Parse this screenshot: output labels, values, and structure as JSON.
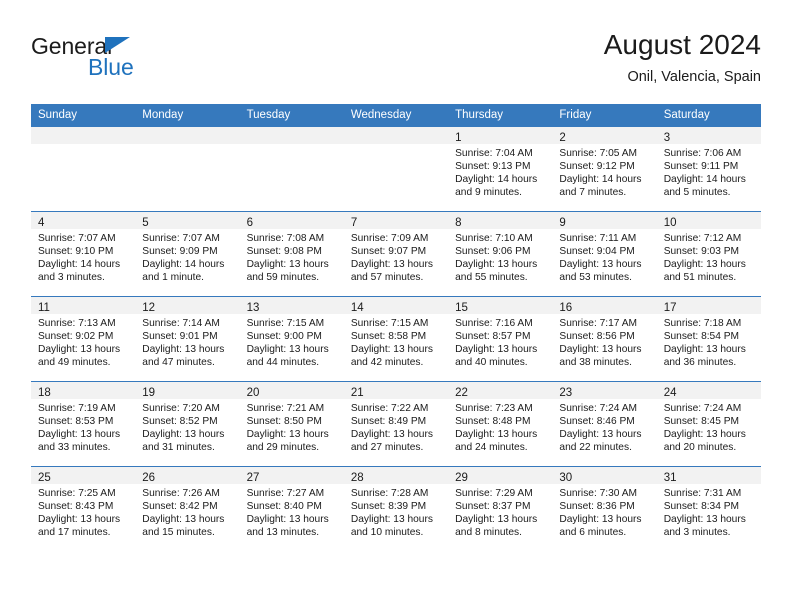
{
  "brand": {
    "name_top": "General",
    "name_bottom": "Blue",
    "triangle_color": "#1f72bd"
  },
  "header": {
    "title": "August 2024",
    "subtitle": "Onil, Valencia, Spain"
  },
  "theme": {
    "header_row_bg": "#3679bd",
    "header_row_text": "#ffffff",
    "daynum_band_bg": "#f2f2f2",
    "cell_border": "#3679bd",
    "text": "#1b1b1b"
  },
  "weekday_headers": [
    "Sunday",
    "Monday",
    "Tuesday",
    "Wednesday",
    "Thursday",
    "Friday",
    "Saturday"
  ],
  "labels": {
    "sunrise_prefix": "Sunrise:",
    "sunset_prefix": "Sunset:",
    "daylight_prefix": "Daylight:"
  },
  "weeks": [
    [
      {
        "day": "",
        "empty": true
      },
      {
        "day": "",
        "empty": true
      },
      {
        "day": "",
        "empty": true
      },
      {
        "day": "",
        "empty": true
      },
      {
        "day": "1",
        "sunrise": "Sunrise: 7:04 AM",
        "sunset": "Sunset: 9:13 PM",
        "daylight_line1": "Daylight: 14 hours",
        "daylight_line2": "and 9 minutes."
      },
      {
        "day": "2",
        "sunrise": "Sunrise: 7:05 AM",
        "sunset": "Sunset: 9:12 PM",
        "daylight_line1": "Daylight: 14 hours",
        "daylight_line2": "and 7 minutes."
      },
      {
        "day": "3",
        "sunrise": "Sunrise: 7:06 AM",
        "sunset": "Sunset: 9:11 PM",
        "daylight_line1": "Daylight: 14 hours",
        "daylight_line2": "and 5 minutes."
      }
    ],
    [
      {
        "day": "4",
        "sunrise": "Sunrise: 7:07 AM",
        "sunset": "Sunset: 9:10 PM",
        "daylight_line1": "Daylight: 14 hours",
        "daylight_line2": "and 3 minutes."
      },
      {
        "day": "5",
        "sunrise": "Sunrise: 7:07 AM",
        "sunset": "Sunset: 9:09 PM",
        "daylight_line1": "Daylight: 14 hours",
        "daylight_line2": "and 1 minute."
      },
      {
        "day": "6",
        "sunrise": "Sunrise: 7:08 AM",
        "sunset": "Sunset: 9:08 PM",
        "daylight_line1": "Daylight: 13 hours",
        "daylight_line2": "and 59 minutes."
      },
      {
        "day": "7",
        "sunrise": "Sunrise: 7:09 AM",
        "sunset": "Sunset: 9:07 PM",
        "daylight_line1": "Daylight: 13 hours",
        "daylight_line2": "and 57 minutes."
      },
      {
        "day": "8",
        "sunrise": "Sunrise: 7:10 AM",
        "sunset": "Sunset: 9:06 PM",
        "daylight_line1": "Daylight: 13 hours",
        "daylight_line2": "and 55 minutes."
      },
      {
        "day": "9",
        "sunrise": "Sunrise: 7:11 AM",
        "sunset": "Sunset: 9:04 PM",
        "daylight_line1": "Daylight: 13 hours",
        "daylight_line2": "and 53 minutes."
      },
      {
        "day": "10",
        "sunrise": "Sunrise: 7:12 AM",
        "sunset": "Sunset: 9:03 PM",
        "daylight_line1": "Daylight: 13 hours",
        "daylight_line2": "and 51 minutes."
      }
    ],
    [
      {
        "day": "11",
        "sunrise": "Sunrise: 7:13 AM",
        "sunset": "Sunset: 9:02 PM",
        "daylight_line1": "Daylight: 13 hours",
        "daylight_line2": "and 49 minutes."
      },
      {
        "day": "12",
        "sunrise": "Sunrise: 7:14 AM",
        "sunset": "Sunset: 9:01 PM",
        "daylight_line1": "Daylight: 13 hours",
        "daylight_line2": "and 47 minutes."
      },
      {
        "day": "13",
        "sunrise": "Sunrise: 7:15 AM",
        "sunset": "Sunset: 9:00 PM",
        "daylight_line1": "Daylight: 13 hours",
        "daylight_line2": "and 44 minutes."
      },
      {
        "day": "14",
        "sunrise": "Sunrise: 7:15 AM",
        "sunset": "Sunset: 8:58 PM",
        "daylight_line1": "Daylight: 13 hours",
        "daylight_line2": "and 42 minutes."
      },
      {
        "day": "15",
        "sunrise": "Sunrise: 7:16 AM",
        "sunset": "Sunset: 8:57 PM",
        "daylight_line1": "Daylight: 13 hours",
        "daylight_line2": "and 40 minutes."
      },
      {
        "day": "16",
        "sunrise": "Sunrise: 7:17 AM",
        "sunset": "Sunset: 8:56 PM",
        "daylight_line1": "Daylight: 13 hours",
        "daylight_line2": "and 38 minutes."
      },
      {
        "day": "17",
        "sunrise": "Sunrise: 7:18 AM",
        "sunset": "Sunset: 8:54 PM",
        "daylight_line1": "Daylight: 13 hours",
        "daylight_line2": "and 36 minutes."
      }
    ],
    [
      {
        "day": "18",
        "sunrise": "Sunrise: 7:19 AM",
        "sunset": "Sunset: 8:53 PM",
        "daylight_line1": "Daylight: 13 hours",
        "daylight_line2": "and 33 minutes."
      },
      {
        "day": "19",
        "sunrise": "Sunrise: 7:20 AM",
        "sunset": "Sunset: 8:52 PM",
        "daylight_line1": "Daylight: 13 hours",
        "daylight_line2": "and 31 minutes."
      },
      {
        "day": "20",
        "sunrise": "Sunrise: 7:21 AM",
        "sunset": "Sunset: 8:50 PM",
        "daylight_line1": "Daylight: 13 hours",
        "daylight_line2": "and 29 minutes."
      },
      {
        "day": "21",
        "sunrise": "Sunrise: 7:22 AM",
        "sunset": "Sunset: 8:49 PM",
        "daylight_line1": "Daylight: 13 hours",
        "daylight_line2": "and 27 minutes."
      },
      {
        "day": "22",
        "sunrise": "Sunrise: 7:23 AM",
        "sunset": "Sunset: 8:48 PM",
        "daylight_line1": "Daylight: 13 hours",
        "daylight_line2": "and 24 minutes."
      },
      {
        "day": "23",
        "sunrise": "Sunrise: 7:24 AM",
        "sunset": "Sunset: 8:46 PM",
        "daylight_line1": "Daylight: 13 hours",
        "daylight_line2": "and 22 minutes."
      },
      {
        "day": "24",
        "sunrise": "Sunrise: 7:24 AM",
        "sunset": "Sunset: 8:45 PM",
        "daylight_line1": "Daylight: 13 hours",
        "daylight_line2": "and 20 minutes."
      }
    ],
    [
      {
        "day": "25",
        "sunrise": "Sunrise: 7:25 AM",
        "sunset": "Sunset: 8:43 PM",
        "daylight_line1": "Daylight: 13 hours",
        "daylight_line2": "and 17 minutes."
      },
      {
        "day": "26",
        "sunrise": "Sunrise: 7:26 AM",
        "sunset": "Sunset: 8:42 PM",
        "daylight_line1": "Daylight: 13 hours",
        "daylight_line2": "and 15 minutes."
      },
      {
        "day": "27",
        "sunrise": "Sunrise: 7:27 AM",
        "sunset": "Sunset: 8:40 PM",
        "daylight_line1": "Daylight: 13 hours",
        "daylight_line2": "and 13 minutes."
      },
      {
        "day": "28",
        "sunrise": "Sunrise: 7:28 AM",
        "sunset": "Sunset: 8:39 PM",
        "daylight_line1": "Daylight: 13 hours",
        "daylight_line2": "and 10 minutes."
      },
      {
        "day": "29",
        "sunrise": "Sunrise: 7:29 AM",
        "sunset": "Sunset: 8:37 PM",
        "daylight_line1": "Daylight: 13 hours",
        "daylight_line2": "and 8 minutes."
      },
      {
        "day": "30",
        "sunrise": "Sunrise: 7:30 AM",
        "sunset": "Sunset: 8:36 PM",
        "daylight_line1": "Daylight: 13 hours",
        "daylight_line2": "and 6 minutes."
      },
      {
        "day": "31",
        "sunrise": "Sunrise: 7:31 AM",
        "sunset": "Sunset: 8:34 PM",
        "daylight_line1": "Daylight: 13 hours",
        "daylight_line2": "and 3 minutes."
      }
    ]
  ]
}
